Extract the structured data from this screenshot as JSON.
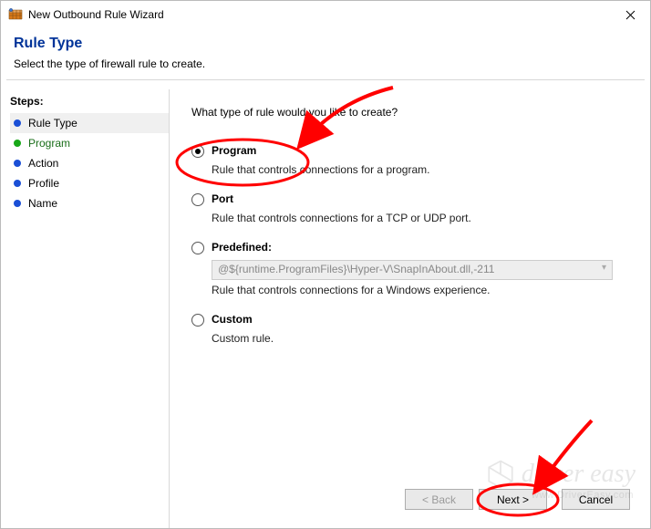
{
  "titlebar": {
    "text": "New Outbound Rule Wizard"
  },
  "heading": "Rule Type",
  "subheading": "Select the type of firewall rule to create.",
  "sidebar": {
    "title": "Steps:",
    "items": [
      {
        "label": "Rule Type"
      },
      {
        "label": "Program"
      },
      {
        "label": "Action"
      },
      {
        "label": "Profile"
      },
      {
        "label": "Name"
      }
    ]
  },
  "content": {
    "question": "What type of rule would you like to create?",
    "options": [
      {
        "label": "Program",
        "desc": "Rule that controls connections for a program."
      },
      {
        "label": "Port",
        "desc": "Rule that controls connections for a TCP or UDP port."
      },
      {
        "label": "Predefined:",
        "desc": "Rule that controls connections for a Windows experience.",
        "combo": "@${runtime.ProgramFiles}\\Hyper-V\\SnapInAbout.dll,-211"
      },
      {
        "label": "Custom",
        "desc": "Custom rule."
      }
    ]
  },
  "footer": {
    "back": "< Back",
    "next": "Next >",
    "cancel": "Cancel"
  },
  "watermark": {
    "brand": "driver easy",
    "url": "www.DriverEasy.com"
  }
}
